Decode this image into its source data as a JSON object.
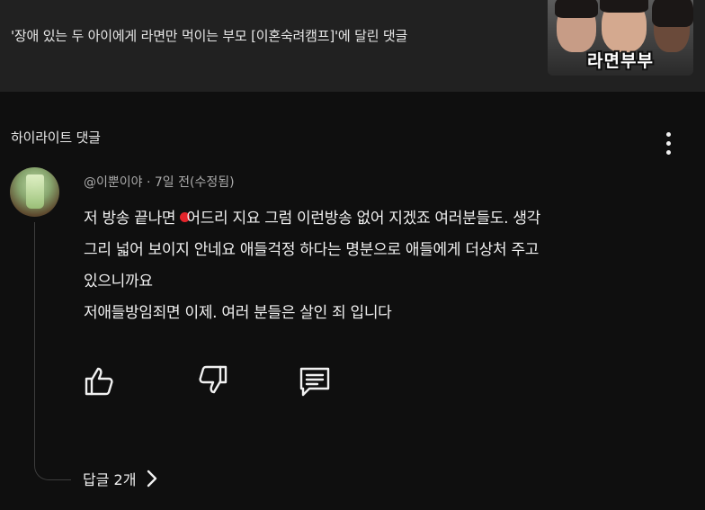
{
  "video": {
    "title": "'장애 있는 두 아이에게 라면만 먹이는 부모 [이혼숙려캠프]'에 달린 댓글",
    "thumbnail_label": "라면부부"
  },
  "section": {
    "title": "하이라이트 댓글"
  },
  "comment": {
    "author": "@이뿐이야",
    "separator": " · ",
    "time": "7일 전(수정됨)",
    "lines": [
      {
        "before": "저 방송 끝나면 ",
        "after": "어드리 지요 그럼 이런방송 없어 지겠죠 여러분들도. 생각"
      },
      {
        "text": "그리 넓어 보이지 안네요 애들걱정 하다는 명분으로 애들에게 더상처 주고"
      },
      {
        "text": "있으니까요"
      },
      {
        "text": "저애들방임죄면 이제. 여러 분들은 살인 죄 입니다"
      }
    ],
    "replies_label": "답글 2개"
  },
  "icons": {
    "like": "thumbs-up-icon",
    "dislike": "thumbs-down-icon",
    "reply": "comment-icon",
    "more": "more-vertical-icon",
    "chevron": "chevron-right-icon"
  },
  "colors": {
    "background": "#0f0f0f",
    "header_background": "#212121",
    "text_primary": "#f1f1f1",
    "text_secondary": "#aaaaaa",
    "record_dot": "#e3242b"
  }
}
